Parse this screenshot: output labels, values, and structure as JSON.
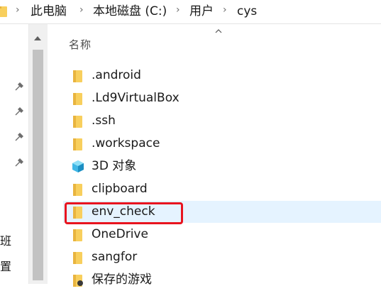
{
  "address_bar": {
    "breadcrumbs": [
      "此电脑",
      "本地磁盘 (C:)",
      "用户",
      "cys"
    ],
    "separator": "›"
  },
  "nav": {
    "partial_labels": [
      "班",
      "置"
    ]
  },
  "list": {
    "column_name": "名称",
    "items": [
      {
        "name": ".android",
        "icon": "folder-icon"
      },
      {
        "name": ".Ld9VirtualBox",
        "icon": "folder-icon"
      },
      {
        "name": ".ssh",
        "icon": "folder-icon"
      },
      {
        "name": ".workspace",
        "icon": "folder-icon"
      },
      {
        "name": "3D 对象",
        "icon": "3d-objects-icon"
      },
      {
        "name": "clipboard",
        "icon": "folder-icon"
      },
      {
        "name": "env_check",
        "icon": "folder-icon",
        "hovered": true,
        "annotated": true
      },
      {
        "name": "OneDrive",
        "icon": "folder-icon"
      },
      {
        "name": "sangfor",
        "icon": "folder-icon"
      },
      {
        "name": "保存的游戏",
        "icon": "saved-games-icon"
      }
    ]
  },
  "colors": {
    "folder": "#f8cf5d",
    "hover": "#e5f3ff",
    "annotation": "#e8141f"
  }
}
